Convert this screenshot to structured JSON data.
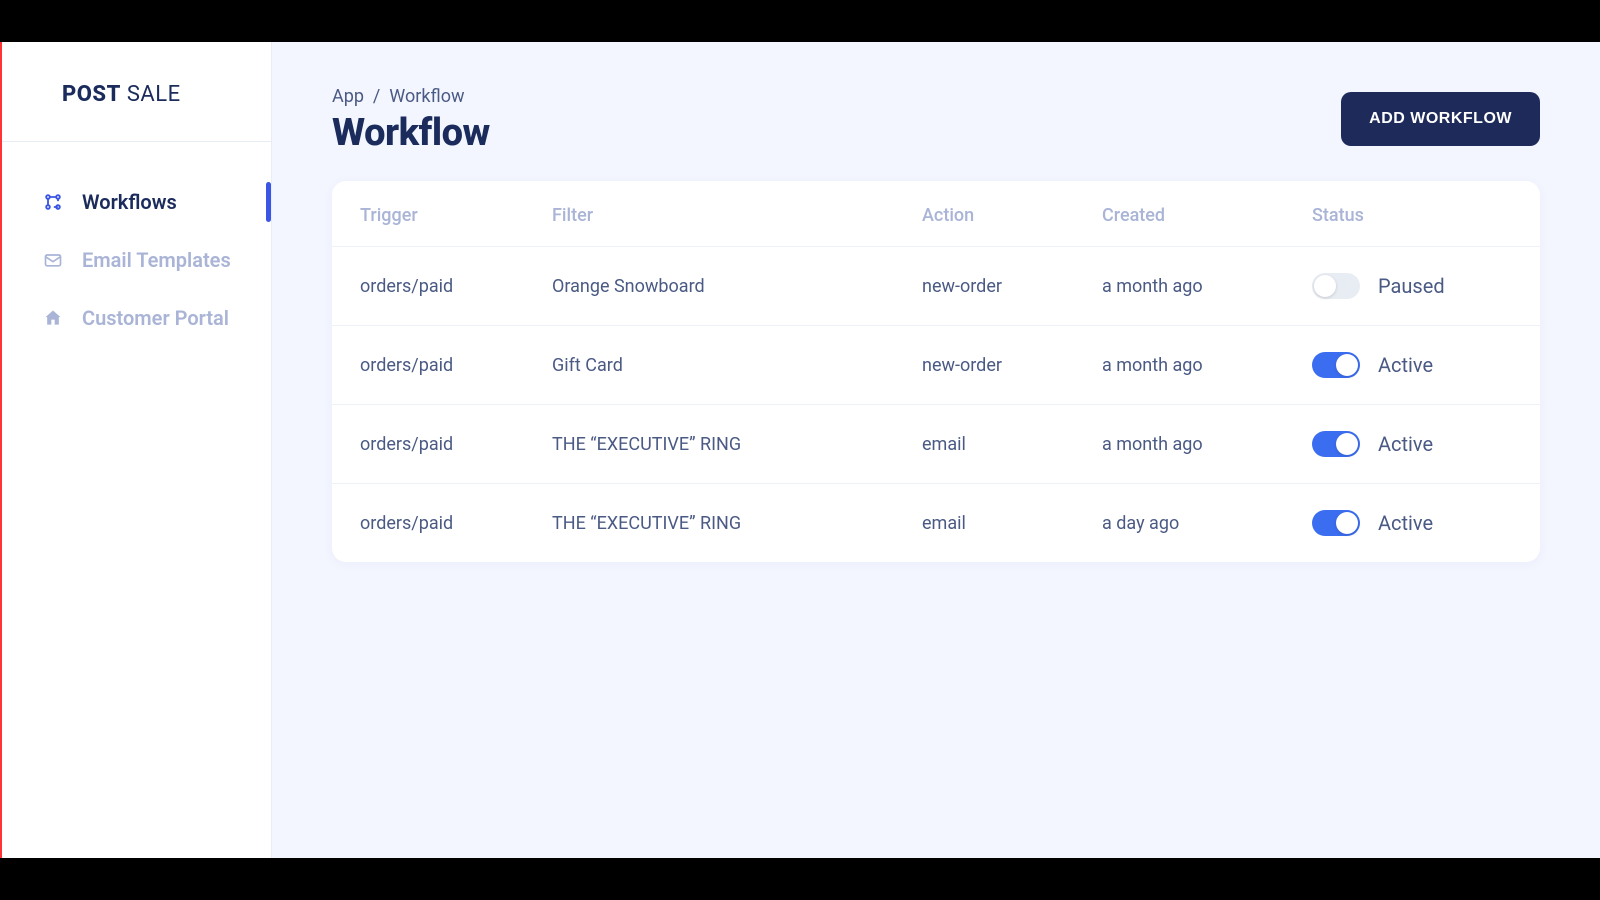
{
  "logo": {
    "part1": "POST",
    "part2": "SALE"
  },
  "sidebar": {
    "items": [
      {
        "label": "Workflows",
        "active": true,
        "icon": "workflow"
      },
      {
        "label": "Email Templates",
        "active": false,
        "icon": "mail"
      },
      {
        "label": "Customer Portal",
        "active": false,
        "icon": "home"
      }
    ]
  },
  "breadcrumb": {
    "root": "App",
    "sep": "/",
    "current": "Workflow"
  },
  "page_title": "Workflow",
  "add_button": "ADD WORKFLOW",
  "table": {
    "headers": {
      "trigger": "Trigger",
      "filter": "Filter",
      "action": "Action",
      "created": "Created",
      "status": "Status"
    },
    "rows": [
      {
        "trigger": "orders/paid",
        "filter": "Orange Snowboard",
        "action": "new-order",
        "created": "a month ago",
        "status": "Paused",
        "on": false
      },
      {
        "trigger": "orders/paid",
        "filter": "Gift Card",
        "action": "new-order",
        "created": "a month ago",
        "status": "Active",
        "on": true
      },
      {
        "trigger": "orders/paid",
        "filter": "THE “EXECUTIVE” RING",
        "action": "email",
        "created": "a month ago",
        "status": "Active",
        "on": true
      },
      {
        "trigger": "orders/paid",
        "filter": "THE “EXECUTIVE” RING",
        "action": "email",
        "created": "a day ago",
        "status": "Active",
        "on": true
      }
    ]
  }
}
